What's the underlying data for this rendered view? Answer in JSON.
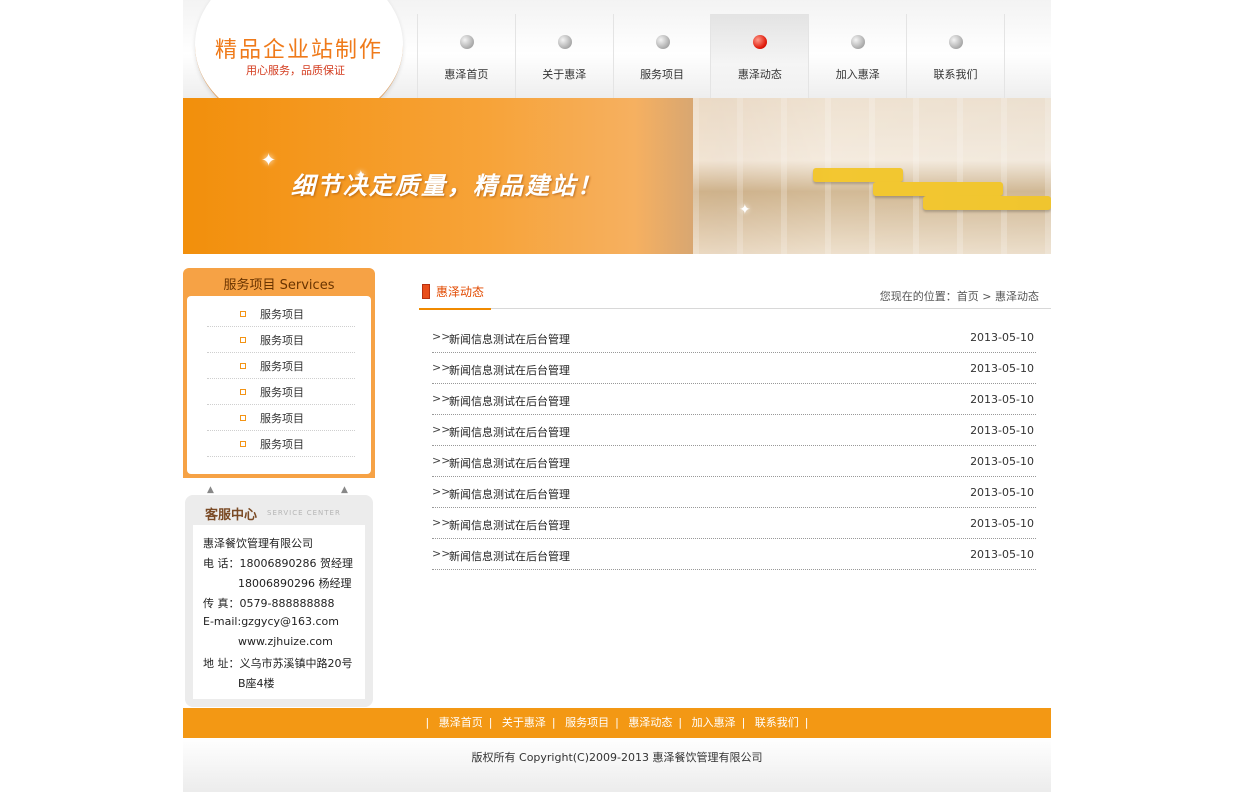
{
  "site": {
    "logo_title": "精品企业站制作",
    "logo_subtitle": "用心服务，品质保证",
    "brand_color": "#f39814",
    "accent_red": "#e24a00"
  },
  "nav": {
    "active": "惠泽动态",
    "items": [
      {
        "label": "惠泽首页"
      },
      {
        "label": "关于惠泽"
      },
      {
        "label": "服务项目"
      },
      {
        "label": "惠泽动态"
      },
      {
        "label": "加入惠泽"
      },
      {
        "label": "联系我们"
      }
    ]
  },
  "banner": {
    "slogan": "细节决定质量，精品建站！"
  },
  "sidebar": {
    "services_title": "服务项目   Services",
    "services": [
      {
        "label": "服务项目"
      },
      {
        "label": "服务项目"
      },
      {
        "label": "服务项目"
      },
      {
        "label": "服务项目"
      },
      {
        "label": "服务项目"
      },
      {
        "label": "服务项目"
      }
    ],
    "customer_service": {
      "title": "客服中心",
      "title_en": "SERVICE CENTER",
      "lines": [
        "惠泽餐饮管理有限公司",
        "电  话：18006890286 贺经理",
        "18006890296 杨经理",
        "传  真：0579-888888888",
        "E-mail:gzgycy@163.com",
        "www.zjhuize.com",
        "地  址：义乌市苏溪镇中路20号",
        "B座4楼"
      ]
    }
  },
  "main": {
    "title": "惠泽动态",
    "breadcrumb": "您现在的位置：首页 > 惠泽动态",
    "news": [
      {
        "title": "新闻信息测试在后台管理",
        "date": "2013-05-10"
      },
      {
        "title": "新闻信息测试在后台管理",
        "date": "2013-05-10"
      },
      {
        "title": "新闻信息测试在后台管理",
        "date": "2013-05-10"
      },
      {
        "title": "新闻信息测试在后台管理",
        "date": "2013-05-10"
      },
      {
        "title": "新闻信息测试在后台管理",
        "date": "2013-05-10"
      },
      {
        "title": "新闻信息测试在后台管理",
        "date": "2013-05-10"
      },
      {
        "title": "新闻信息测试在后台管理",
        "date": "2013-05-10"
      },
      {
        "title": "新闻信息测试在后台管理",
        "date": "2013-05-10"
      }
    ]
  },
  "footer": {
    "links": [
      {
        "label": "惠泽首页"
      },
      {
        "label": "关于惠泽"
      },
      {
        "label": "服务项目"
      },
      {
        "label": "惠泽动态"
      },
      {
        "label": "加入惠泽"
      },
      {
        "label": "联系我们"
      }
    ],
    "copyright": "版权所有 Copyright(C)2009-2013 惠泽餐饮管理有限公司"
  }
}
